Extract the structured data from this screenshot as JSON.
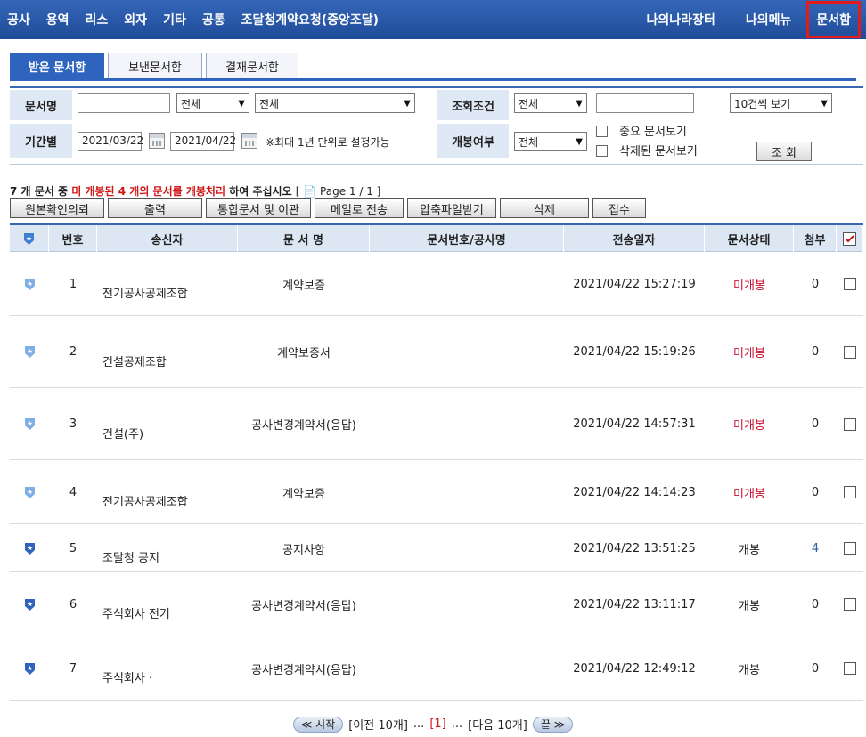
{
  "nav": {
    "left": [
      "공사",
      "용역",
      "리스",
      "외자",
      "기타",
      "공통",
      "조달청계약요청(중앙조달)"
    ],
    "right": [
      "나의나라장터",
      "나의메뉴",
      "문서함"
    ]
  },
  "tabs": [
    "받은 문서함",
    "보낸문서함",
    "결재문서함"
  ],
  "search": {
    "doc_name_label": "문서명",
    "doc_name_value": "",
    "select_all_1": "전체",
    "select_all_2": "전체",
    "query_label": "조회조건",
    "query_select": "전체",
    "query_input": "",
    "page_size": "10건씩 보기",
    "period_label": "기간별",
    "date_from": "2021/03/22",
    "date_to": "2021/04/22",
    "period_note": "※최대 1년 단위로 설정가능",
    "open_label": "개봉여부",
    "open_select": "전체",
    "important_label": "중요 문서보기",
    "deleted_label": "삭제된 문서보기",
    "search_button": "조 회"
  },
  "summary": {
    "part1": "7 개 문서 중",
    "part2": "미 개봉된 4 개의 문서를 개봉처리",
    "part3": "하여 주십시오",
    "page": "[ 📄 Page 1 / 1 ]"
  },
  "actions": [
    "원본확인의뢰",
    "출력",
    "통합문서 및 이관",
    "메일로 전송",
    "압축파일받기",
    "삭제",
    "접수"
  ],
  "table": {
    "headers": [
      "번호",
      "송신자",
      "문 서 명",
      "문서번호/공사명",
      "전송일자",
      "문서상태",
      "첨부"
    ],
    "rows": [
      {
        "no": "1",
        "sender": "전기공사공제조합",
        "doc": "계약보증",
        "date": "2021/04/22 15:27:19",
        "status": "미개봉",
        "attach": "0"
      },
      {
        "no": "2",
        "sender": "건설공제조합",
        "doc": "계약보증서",
        "date": "2021/04/22 15:19:26",
        "status": "미개봉",
        "attach": "0"
      },
      {
        "no": "3",
        "sender": "건설(주)",
        "doc": "공사변경계약서(응답)",
        "date": "2021/04/22 14:57:31",
        "status": "미개봉",
        "attach": "0"
      },
      {
        "no": "4",
        "sender": "전기공사공제조합",
        "doc": "계약보증",
        "date": "2021/04/22 14:14:23",
        "status": "미개봉",
        "attach": "0"
      },
      {
        "no": "5",
        "sender": "조달청 공지",
        "doc": "공지사항",
        "date": "2021/04/22 13:51:25",
        "status": "개봉",
        "attach": "4"
      },
      {
        "no": "6",
        "sender": "주식회사        전기",
        "doc": "공사변경계약서(응답)",
        "date": "2021/04/22 13:11:17",
        "status": "개봉",
        "attach": "0"
      },
      {
        "no": "7",
        "sender": "주식회사 ·",
        "doc": "공사변경계약서(응답)",
        "date": "2021/04/22 12:49:12",
        "status": "개봉",
        "attach": "0"
      }
    ]
  },
  "pager": {
    "first": "≪ 시작",
    "prev": "[이전 10개]",
    "ellipsis1": "...",
    "current": "[1]",
    "ellipsis2": "...",
    "next": "[다음 10개]",
    "last": "끝 ≫"
  },
  "colors": {
    "nav_bg": "#1f4c99",
    "accent": "#2f64be",
    "unopened": "#c8102e",
    "highlight": "#e21b1b"
  }
}
